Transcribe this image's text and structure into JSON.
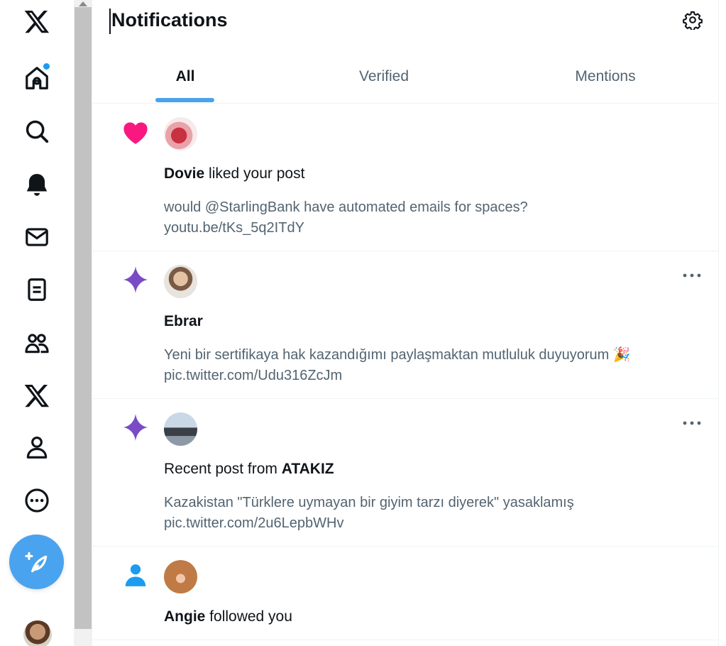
{
  "nav": {
    "items": [
      {
        "name": "x-logo-icon"
      },
      {
        "name": "home-icon"
      },
      {
        "name": "search-icon"
      },
      {
        "name": "notifications-bell-icon"
      },
      {
        "name": "messages-icon"
      },
      {
        "name": "lists-icon"
      },
      {
        "name": "communities-icon"
      },
      {
        "name": "premium-x-icon"
      },
      {
        "name": "profile-icon"
      },
      {
        "name": "more-icon"
      }
    ],
    "compose_icon": "compose-feather-icon",
    "accent_color": "#1d9bf0"
  },
  "header": {
    "title": "Notifications",
    "settings_icon": "gear-icon"
  },
  "tabs": [
    {
      "label": "All",
      "active": true
    },
    {
      "label": "Verified",
      "active": false
    },
    {
      "label": "Mentions",
      "active": false
    }
  ],
  "notifications": [
    {
      "type": "like",
      "icon": "heart-icon",
      "icon_color": "#f91880",
      "actor": "Dovie",
      "action": " liked your post",
      "text_line1": "would @StarlingBank  have automated emails for spaces?",
      "text_line2": "youtu.be/tKs_5q2ITdY"
    },
    {
      "type": "recommended",
      "icon": "sparkle-icon",
      "icon_color": "#794bc4",
      "actor": "Ebrar",
      "action": "",
      "text_line1": "Yeni bir sertifikaya hak kazandığımı paylaşmaktan mutluluk duyuyorum 🎉",
      "text_line2": "pic.twitter.com/Udu316ZcJm"
    },
    {
      "type": "recent_post",
      "icon": "sparkle-icon",
      "icon_color": "#794bc4",
      "prefix": "Recent post from ",
      "actor": "ATAKIZ",
      "text_line1": "Kazakistan \"Türklere uymayan bir giyim tarzı diyerek\" yasaklamış",
      "text_line2": "pic.twitter.com/2u6LepbWHv"
    },
    {
      "type": "follow",
      "icon": "person-icon",
      "icon_color": "#1d9bf0",
      "actor": "Angie",
      "action": " followed you"
    }
  ]
}
